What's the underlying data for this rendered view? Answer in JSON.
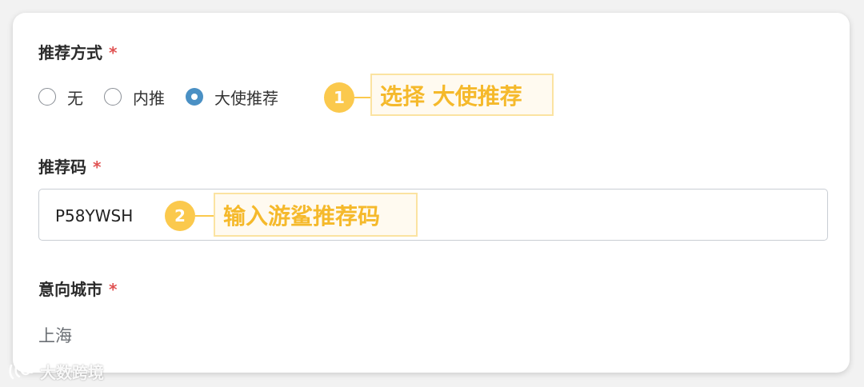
{
  "form": {
    "referral_method": {
      "label": "推荐方式",
      "required_mark": "*",
      "options": [
        {
          "label": "无",
          "checked": false
        },
        {
          "label": "内推",
          "checked": false
        },
        {
          "label": "大使推荐",
          "checked": true
        }
      ]
    },
    "referral_code": {
      "label": "推荐码",
      "required_mark": "*",
      "value": "P58YWSH"
    },
    "city": {
      "label": "意向城市",
      "required_mark": "*",
      "value": "上海"
    }
  },
  "annotations": [
    {
      "number": "1",
      "text": "选择 大使推荐"
    },
    {
      "number": "2",
      "text": "输入游鲨推荐码"
    }
  ],
  "watermark": {
    "text": "大数跨境"
  },
  "colors": {
    "accent_radio": "#4a90c4",
    "annotation": "#fbc94d",
    "annotation_text": "#f5b92b",
    "required": "#e05252"
  }
}
